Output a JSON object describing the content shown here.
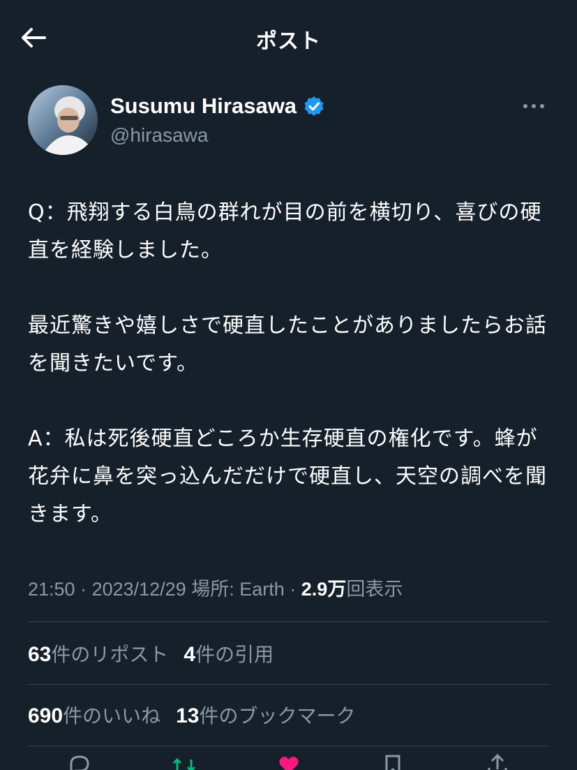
{
  "header": {
    "title": "ポスト",
    "back_icon": "arrow-left-icon"
  },
  "author": {
    "display_name": "Susumu Hirasawa",
    "handle": "@hirasawa",
    "verified": true,
    "verified_color": "#1d9bf0",
    "avatar_icon": "user-avatar",
    "more_icon": "more-horizontal-icon"
  },
  "tweet": {
    "text": "Q：飛翔する白鳥の群れが目の前を横切り、喜びの硬直を経験しました。\n\n最近驚きや嬉しさで硬直したことがありましたらお話を聞きたいです。\n\nA：私は死後硬直どころか生存硬直の権化です。蜂が花弁に鼻を突っ込んだだけで硬直し、天空の調べを聞きます。"
  },
  "meta": {
    "time": "21:50",
    "separator": " · ",
    "date": "2023/12/29",
    "location_label": "場所: Earth",
    "views_count": "2.9万",
    "views_label": "回表示"
  },
  "stats": {
    "reposts_count": "63",
    "reposts_label": "件のリポスト",
    "quotes_count": "4",
    "quotes_label": "件の引用",
    "likes_count": "690",
    "likes_label": "件のいいね",
    "bookmarks_count": "13",
    "bookmarks_label": "件のブックマーク"
  },
  "actions": [
    "reply-icon",
    "repost-icon",
    "like-icon",
    "bookmark-icon",
    "share-icon"
  ],
  "colors": {
    "background": "#15202b",
    "text_primary": "#ffffff",
    "text_secondary": "#8b98a5",
    "divider": "#38444d",
    "accent": "#1d9bf0"
  }
}
